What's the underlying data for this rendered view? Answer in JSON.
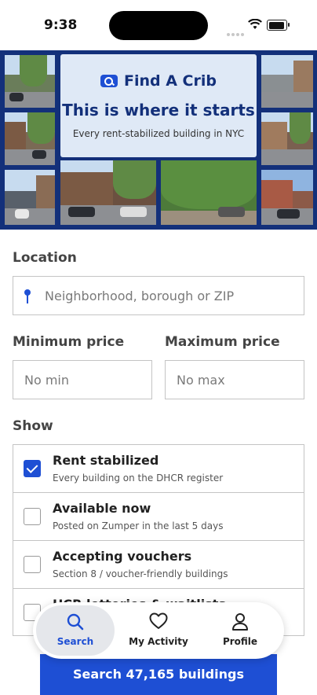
{
  "status_bar": {
    "time": "9:38"
  },
  "hero": {
    "brand_name": "Find A Crib",
    "title": "This is where it starts",
    "subtitle": "Every rent-stabilized building in NYC"
  },
  "form": {
    "location_label": "Location",
    "location_placeholder": "Neighborhood, borough or ZIP",
    "min_price_label": "Minimum price",
    "min_price_placeholder": "No min",
    "max_price_label": "Maximum price",
    "max_price_placeholder": "No max",
    "show_label": "Show"
  },
  "options": [
    {
      "title": "Rent stabilized",
      "subtitle": "Every building on the DHCR register",
      "checked": true
    },
    {
      "title": "Available now",
      "subtitle": "Posted on Zumper in the last 5 days",
      "checked": false
    },
    {
      "title": "Accepting vouchers",
      "subtitle": "Section 8 / voucher-friendly buildings",
      "checked": false
    },
    {
      "title": "HCR lotteries & waitlists",
      "subtitle": "",
      "checked": false
    }
  ],
  "tabs": [
    {
      "label": "Search",
      "icon": "search-icon",
      "active": true
    },
    {
      "label": "My Activity",
      "icon": "heart-icon",
      "active": false
    },
    {
      "label": "Profile",
      "icon": "person-icon",
      "active": false
    }
  ],
  "cta_label": "Search 47,165 buildings",
  "colors": {
    "accent": "#1e4fd4",
    "hero_bg": "#13307a",
    "brand_card": "#dfe9f6"
  }
}
